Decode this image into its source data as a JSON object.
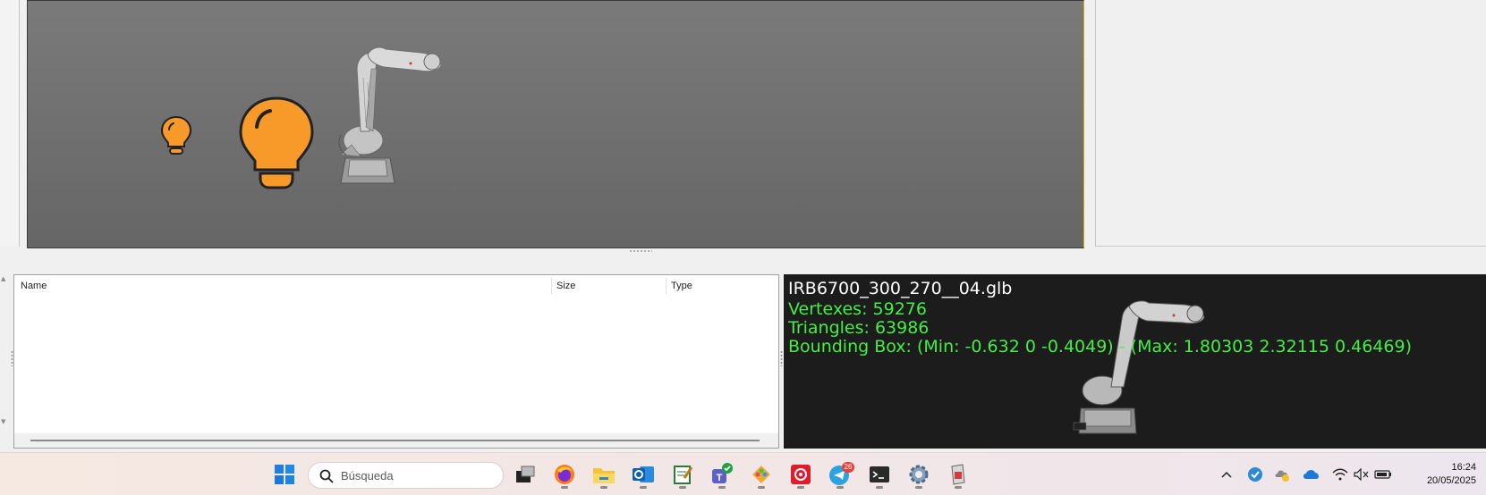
{
  "file_list": {
    "columns": [
      "Name",
      "Size",
      "Type"
    ]
  },
  "preview": {
    "filename": "IRB6700_300_270__04.glb",
    "vertexes": "Vertexes: 59276",
    "triangles": "Triangles: 63986",
    "bounding_box": "Bounding Box: (Min: -0.632 0 -0.4049) - (Max: 1.80303 2.32115 0.46469)",
    "text_color": "#44ee44"
  },
  "viewport": {
    "background": "#707070",
    "icons": [
      "light-bulb-icon",
      "light-bulb-icon",
      "robot-arm-model"
    ]
  },
  "taskbar": {
    "search_placeholder": "Búsqueda",
    "apps": [
      "start-icon",
      "task-view-icon",
      "firefox-icon",
      "file-explorer-icon",
      "outlook-icon",
      "notepad-icon",
      "teams-icon",
      "git-icon",
      "app-red-icon",
      "telegram-icon",
      "terminal-icon",
      "settings-gear-icon",
      "app-icon"
    ],
    "telegram_badge": "26",
    "clock_time": "16:24",
    "clock_date": "20/05/2025"
  }
}
